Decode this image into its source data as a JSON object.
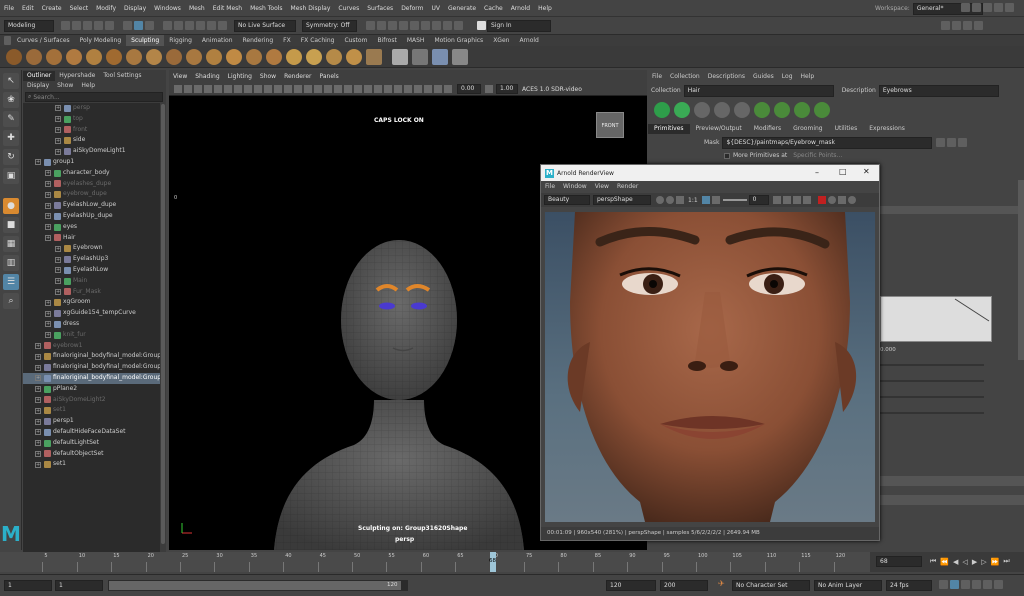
{
  "menu": [
    "File",
    "Edit",
    "Create",
    "Select",
    "Modify",
    "Display",
    "Windows",
    "Mesh",
    "Edit Mesh",
    "Mesh Tools",
    "Mesh Display",
    "Curves",
    "Surfaces",
    "Deform",
    "UV",
    "Generate",
    "Cache",
    "Arnold",
    "Help"
  ],
  "workspace": {
    "label": "Workspace:",
    "value": "General*"
  },
  "status": {
    "mode": "Modeling",
    "live_surface": "No Live Surface",
    "symmetry": "Symmetry: Off",
    "sign_in": "Sign In"
  },
  "shelf_tabs": [
    "Curves / Surfaces",
    "Poly Modeling",
    "Sculpting",
    "Rigging",
    "Animation",
    "Rendering",
    "FX",
    "FX Caching",
    "Custom",
    "Bifrost",
    "MASH",
    "Motion Graphics",
    "XGen",
    "Arnold"
  ],
  "shelf_active": "Sculpting",
  "outliner": {
    "tabs": [
      "Outliner",
      "Hypershade",
      "Tool Settings"
    ],
    "menu": [
      "Display",
      "Show",
      "Help"
    ],
    "search_placeholder": "Search...",
    "items": [
      {
        "label": "persp",
        "indent": 2,
        "dim": true
      },
      {
        "label": "top",
        "indent": 2,
        "dim": true
      },
      {
        "label": "front",
        "indent": 2,
        "dim": true
      },
      {
        "label": "side",
        "indent": 2,
        "dim": false
      },
      {
        "label": "aiSkyDomeLight1",
        "indent": 2,
        "dim": false
      },
      {
        "label": "group1",
        "indent": 0,
        "dim": false
      },
      {
        "label": "character_body",
        "indent": 1,
        "dim": false
      },
      {
        "label": "eyelashes_dupe",
        "indent": 1,
        "dim": true
      },
      {
        "label": "eyebrow_dupe",
        "indent": 1,
        "dim": true
      },
      {
        "label": "EyelashLow_dupe",
        "indent": 1,
        "dim": false
      },
      {
        "label": "EyelashUp_dupe",
        "indent": 1,
        "dim": false
      },
      {
        "label": "eyes",
        "indent": 1,
        "dim": false
      },
      {
        "label": "Hair",
        "indent": 1,
        "dim": false
      },
      {
        "label": "Eyebrown",
        "indent": 2,
        "dim": false
      },
      {
        "label": "EyelashUp3",
        "indent": 2,
        "dim": false
      },
      {
        "label": "EyelashLow",
        "indent": 2,
        "dim": false
      },
      {
        "label": "Main",
        "indent": 2,
        "dim": true
      },
      {
        "label": "Fur_Mask",
        "indent": 2,
        "dim": true
      },
      {
        "label": "xgGroom",
        "indent": 1,
        "dim": false
      },
      {
        "label": "xgGuide154_tempCurve",
        "indent": 1,
        "dim": false
      },
      {
        "label": "dress",
        "indent": 1,
        "dim": false
      },
      {
        "label": "knit_fur",
        "indent": 1,
        "dim": true
      },
      {
        "label": "eyebrow1",
        "indent": 0,
        "dim": true
      },
      {
        "label": "finaloriginal_bodyfinal_model:Group",
        "indent": 0,
        "dim": false
      },
      {
        "label": "finaloriginal_bodyfinal_model:Group1",
        "indent": 0,
        "dim": false
      },
      {
        "label": "finaloriginal_bodyfinal_model:Group",
        "indent": 0,
        "dim": false,
        "sel": true
      },
      {
        "label": "pPlane2",
        "indent": 0,
        "dim": false
      },
      {
        "label": "aiSkyDomeLight2",
        "indent": 0,
        "dim": true
      },
      {
        "label": "set1",
        "indent": 0,
        "dim": true
      },
      {
        "label": "persp1",
        "indent": 0,
        "dim": false
      },
      {
        "label": "defaultHideFaceDataSet",
        "indent": 0,
        "dim": false
      },
      {
        "label": "defaultLightSet",
        "indent": 0,
        "dim": false
      },
      {
        "label": "defaultObjectSet",
        "indent": 0,
        "dim": false
      },
      {
        "label": "set1",
        "indent": 0,
        "dim": false
      }
    ]
  },
  "viewport": {
    "menu": [
      "View",
      "Shading",
      "Lighting",
      "Show",
      "Renderer",
      "Panels"
    ],
    "field1": "0.00",
    "field2": "1.00",
    "colorspace": "ACES 1.0 SDR-video",
    "caps_lock": "CAPS LOCK ON",
    "front_btn": "FRONT",
    "sculpt_label": "Sculpting on: Group31620Shape",
    "camera": "persp",
    "left_zero": "0"
  },
  "xgen": {
    "menu": [
      "File",
      "Collection",
      "Descriptions",
      "Guides",
      "Log",
      "Help"
    ],
    "collection_label": "Collection",
    "collection_value": "Hair",
    "description_label": "Description",
    "description_value": "Eyebrows",
    "tabs": [
      "Primitives",
      "Preview/Output",
      "Modifiers",
      "Grooming",
      "Utilities",
      "Expressions"
    ],
    "mask_label": "Mask",
    "mask_value": "${DESC}/paintmaps/Eyebrow_mask",
    "more_primitives": "More Primitives at",
    "specific_points": "Specific Points...",
    "ramp_value": "0.000"
  },
  "renderview": {
    "title": "Arnold RenderView",
    "menu": [
      "File",
      "Window",
      "View",
      "Render"
    ],
    "aov": "Beauty",
    "camera": "perspShape",
    "ratio": "1:1",
    "exposure": "0",
    "status": "00:01:09 | 960x540 (281%) | perspShape | samples 5/6/2/2/2/2 | 2649.94 MB"
  },
  "timeline": {
    "ticks": [
      "5",
      "10",
      "15",
      "20",
      "25",
      "30",
      "35",
      "40",
      "45",
      "50",
      "55",
      "60",
      "65",
      "70",
      "75",
      "80",
      "85",
      "90",
      "95",
      "100",
      "105",
      "110",
      "115",
      "120"
    ],
    "current": "68",
    "current_field": "68"
  },
  "range": {
    "start": "1",
    "start2": "1",
    "slider_end": "120",
    "end": "120",
    "end2": "200",
    "character_set": "No Character Set",
    "anim_layer": "No Anim Layer",
    "fps": "24 fps"
  },
  "colors": {
    "accent": "#5285a6",
    "hair_highlight": "#e0862a",
    "timeline_marker": "#9ec6d8"
  }
}
